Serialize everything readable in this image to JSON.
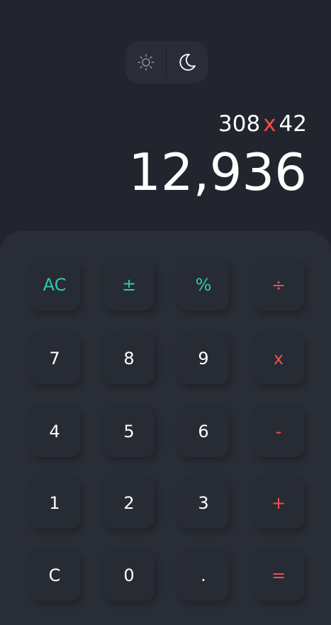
{
  "theme_toggle": {
    "light_icon": "sun-icon",
    "dark_icon": "moon-icon"
  },
  "display": {
    "operand1": "308",
    "operator": "x",
    "operand2": "42",
    "result": "12,936"
  },
  "keys": {
    "ac": "AC",
    "plus_minus": "±",
    "percent": "%",
    "divide": "÷",
    "seven": "7",
    "eight": "8",
    "nine": "9",
    "multiply": "x",
    "four": "4",
    "five": "5",
    "six": "6",
    "minus": "-",
    "one": "1",
    "two": "2",
    "three": "3",
    "plus": "+",
    "clear": "C",
    "zero": "0",
    "decimal": ".",
    "equals": "="
  },
  "colors": {
    "background": "#22252d",
    "keypad": "#292d36",
    "function_accent": "#30c7b2",
    "operator_accent": "#f44d4d"
  }
}
